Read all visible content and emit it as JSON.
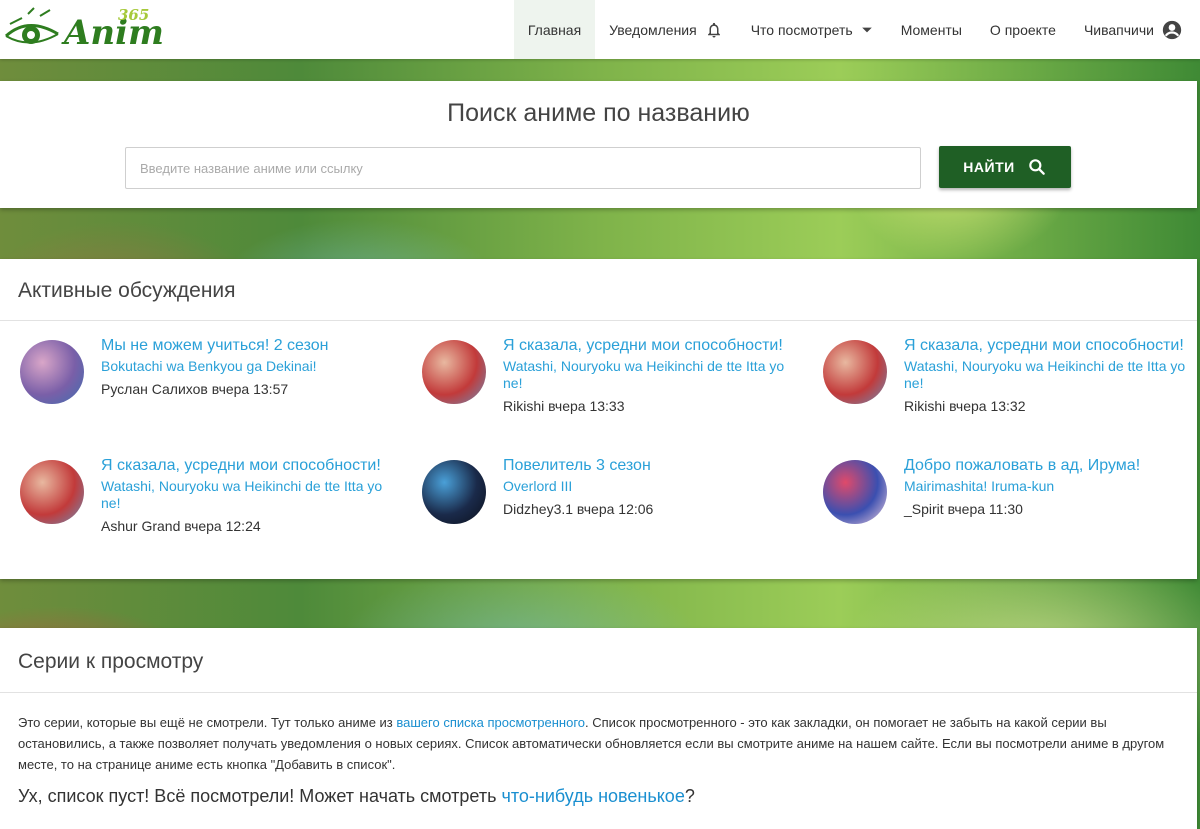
{
  "header": {
    "logo_text": "Anime",
    "logo_number": "365",
    "nav": [
      {
        "label": "Главная",
        "active": true
      },
      {
        "label": "Уведомления",
        "icon": "bell-icon"
      },
      {
        "label": "Что посмотреть",
        "icon": "caret-down-icon"
      },
      {
        "label": "Моменты"
      },
      {
        "label": "О проекте"
      },
      {
        "label": "Чивапчичи",
        "icon": "account-icon"
      }
    ]
  },
  "search": {
    "title": "Поиск аниме по названию",
    "placeholder": "Введите название аниме или ссылку",
    "button_label": "НАЙТИ",
    "button_color": "#1f5f25"
  },
  "discussions": {
    "title": "Активные обсуждения",
    "items": [
      {
        "title": "Мы не можем учиться! 2 сезон",
        "subtitle": "Bokutachi wa Benkyou ga Dekinai!",
        "meta": "Руслан Салихов вчера 13:57",
        "avatar_colors": [
          "#7a5fa8",
          "#d9a6c8",
          "#3d6fb0"
        ]
      },
      {
        "title": "Я сказала, усредни мои способности!",
        "subtitle": "Watashi, Nouryoku wa Heikinchi de tte Itta yo ne!",
        "meta": "Rikishi вчера 13:33",
        "avatar_colors": [
          "#c23a3a",
          "#e8b8a0",
          "#6a8fb8"
        ]
      },
      {
        "title": "Я сказала, усредни мои способности!",
        "subtitle": "Watashi, Nouryoku wa Heikinchi de tte Itta yo ne!",
        "meta": "Rikishi вчера 13:32",
        "avatar_colors": [
          "#c23a3a",
          "#e8b8a0",
          "#6a8fb8"
        ]
      },
      {
        "title": "Я сказала, усредни мои способности!",
        "subtitle": "Watashi, Nouryoku wa Heikinchi de tte Itta yo ne!",
        "meta": "Ashur Grand вчера 12:24",
        "avatar_colors": [
          "#c23a3a",
          "#e8b8a0",
          "#6a8fb8"
        ]
      },
      {
        "title": "Повелитель 3 сезон",
        "subtitle": "Overlord III",
        "meta": "Didzhey3.1 вчера 12:06",
        "avatar_colors": [
          "#1a2a4a",
          "#4aa0d8",
          "#0b0f1a"
        ]
      },
      {
        "title": "Добро пожаловать в ад, Ирума!",
        "subtitle": "Mairimashita! Iruma-kun",
        "meta": "_Spirit вчера 11:30",
        "avatar_colors": [
          "#3b4fb0",
          "#e04a6a",
          "#f2d2e0"
        ]
      }
    ]
  },
  "series": {
    "title": "Серии к просмотру",
    "text_before_link": "Это серии, которые вы ещё не смотрели. Тут только аниме из ",
    "link_text": "вашего списка просмотренного",
    "text_after_link": ". Список просмотренного - это как закладки, он помогает не забыть на какой серии вы остановились, а также позволяет получать уведомления о новых сериях. Список автоматически обновляется если вы смотрите аниме на нашем сайте. Если вы посмотрели аниме в другом месте, то на странице аниме есть кнопка \"Добавить в список\".",
    "empty_before": "Ух, список пуст! Всё посмотрели! Может начать смотреть ",
    "empty_link": "что-нибудь новенькое",
    "empty_after": "?"
  },
  "colors": {
    "accent": "#1f5f25",
    "link": "#2aa0d8",
    "logo_green": "#2e7d1f"
  }
}
